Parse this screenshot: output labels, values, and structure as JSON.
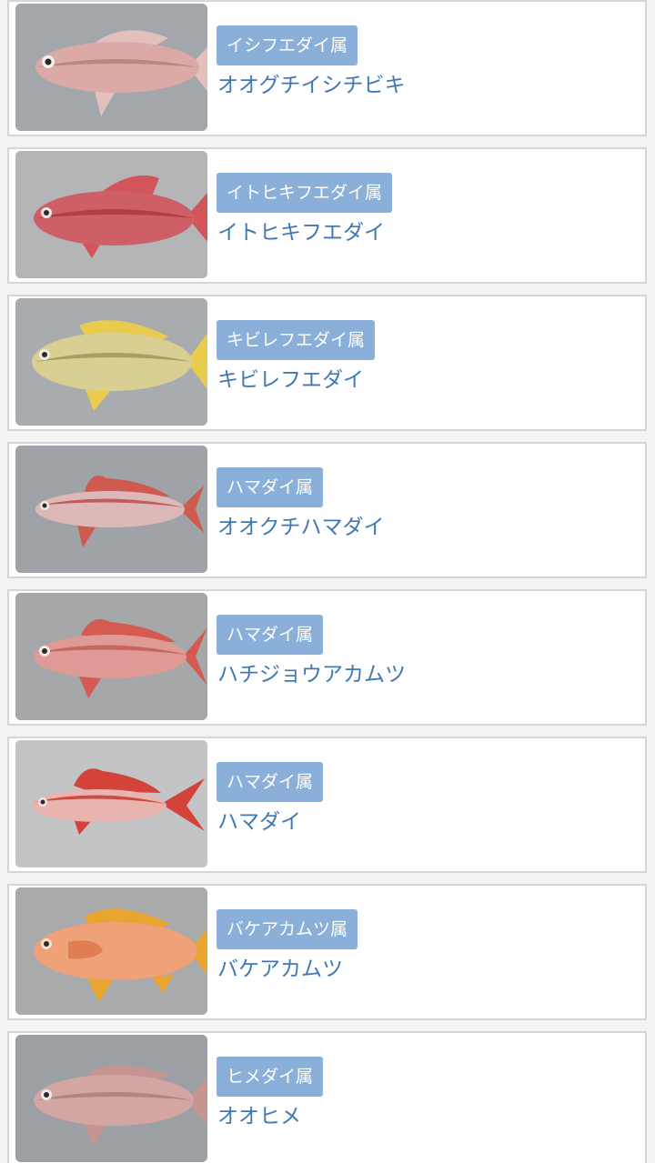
{
  "fish_list": [
    {
      "genus": "イシフエダイ属",
      "name": "オオグチイシチビキ",
      "image": "fish-photo-ooguchiishichibiki",
      "colors": {
        "bg": "#a3a6aa",
        "body": "#dcaaa6",
        "fin": "#e2c1bd",
        "shade": "#b98682"
      }
    },
    {
      "genus": "イトヒキフエダイ属",
      "name": "イトヒキフエダイ",
      "image": "fish-photo-itohikifuedai",
      "colors": {
        "bg": "#b3b5b7",
        "body": "#cf5f66",
        "fin": "#d2555c",
        "shade": "#b03e48"
      }
    },
    {
      "genus": "キビレフエダイ属",
      "name": "キビレフエダイ",
      "image": "fish-photo-kibirefuedai",
      "colors": {
        "bg": "#a9acaf",
        "body": "#d9cf93",
        "fin": "#e9cc4d",
        "shade": "#a99f62"
      }
    },
    {
      "genus": "ハマダイ属",
      "name": "オオクチハマダイ",
      "image": "fish-photo-ookuchihamadai",
      "colors": {
        "bg": "#9fa3a7",
        "body": "#dcb9b8",
        "fin": "#cf5a4e",
        "shade": "#c35c55"
      }
    },
    {
      "genus": "ハマダイ属",
      "name": "ハチジョウアカムツ",
      "image": "fish-photo-hachijouakamutsu",
      "colors": {
        "bg": "#a5a7a9",
        "body": "#e09a96",
        "fin": "#d55a51",
        "shade": "#c6675f"
      }
    },
    {
      "genus": "ハマダイ属",
      "name": "ハマダイ",
      "image": "fish-photo-hamadai",
      "colors": {
        "bg": "#c3c4c6",
        "body": "#e9b3ae",
        "fin": "#d4433a",
        "shade": "#cf4a42"
      }
    },
    {
      "genus": "バケアカムツ属",
      "name": "バケアカムツ",
      "image": "fish-photo-bakeakamutsu",
      "colors": {
        "bg": "#a9aaac",
        "body": "#efa178",
        "fin": "#e9a52f",
        "shade": "#e07d53"
      }
    },
    {
      "genus": "ヒメダイ属",
      "name": "オオヒメ",
      "image": "fish-photo-oohime",
      "colors": {
        "bg": "#9c9fa3",
        "body": "#d3a6a3",
        "fin": "#c69591",
        "shade": "#b38480"
      }
    }
  ],
  "accent": {
    "tag_bg": "#8aafd8",
    "link_text": "#3f79b4",
    "card_border": "#d6d6d6"
  }
}
